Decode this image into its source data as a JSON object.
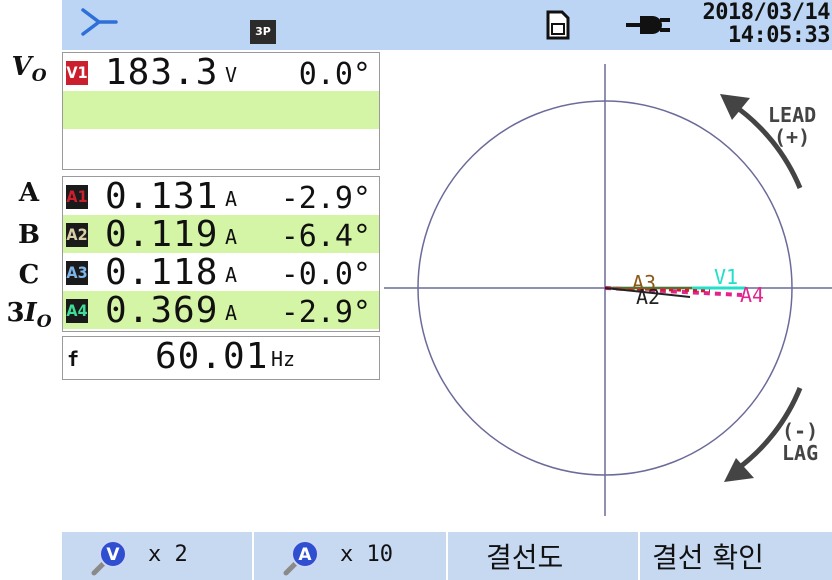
{
  "status_bar": {
    "datetime_date": "2018/03/14",
    "datetime_time": "14:05:33",
    "threephase_icon_text": "3P",
    "icons": [
      "wiring-star-icon",
      "three-phase-icon",
      "sd-card-icon",
      "power-plug-icon"
    ]
  },
  "side_labels": {
    "v0_main": "V",
    "v0_sub": "O",
    "a": "A",
    "b": "B",
    "c": "C",
    "i0_prefix": "3",
    "i0_main": "I",
    "i0_sub": "O"
  },
  "voltage": {
    "badge": "V1",
    "badge_color": "#cc1f2e",
    "value": "183.3",
    "unit": "V",
    "angle": "0.0°"
  },
  "currents": [
    {
      "badge": "A1",
      "badge_color": "#cc1f2e",
      "value": "0.131",
      "unit": "A",
      "angle": "-2.9°"
    },
    {
      "badge": "A2",
      "badge_color": "#d9cfa6",
      "value": "0.119",
      "unit": "A",
      "angle": "-6.4°"
    },
    {
      "badge": "A3",
      "badge_color": "#7fb4e8",
      "value": "0.118",
      "unit": "A",
      "angle": "-0.0°"
    },
    {
      "badge": "A4",
      "badge_color": "#3ddc97",
      "value": "0.369",
      "unit": "A",
      "angle": "-2.9°"
    }
  ],
  "frequency": {
    "label": "f",
    "value": "60.01",
    "unit": "Hz"
  },
  "vector_diagram": {
    "lead_label_line1": "LEAD",
    "lead_label_line2": "(+)",
    "lag_label_line1": "(-)",
    "lag_label_line2": "LAG",
    "vector_labels": {
      "v1": "V1",
      "a2": "A2",
      "a3": "A3",
      "a4": "A4"
    },
    "colors": {
      "v1": "#20e0c8",
      "a1": "#cc1f2e",
      "a2": "#222222",
      "a3": "#8a5a1a",
      "a4": "#e0268e"
    }
  },
  "bottom_bar": {
    "voltage_zoom_icon_letter": "V",
    "voltage_zoom_multiplier": "x 2",
    "current_zoom_icon_letter": "A",
    "current_zoom_multiplier": "x 10",
    "wiring_diagram_label": "결선도",
    "wiring_check_label": "결선 확인"
  }
}
